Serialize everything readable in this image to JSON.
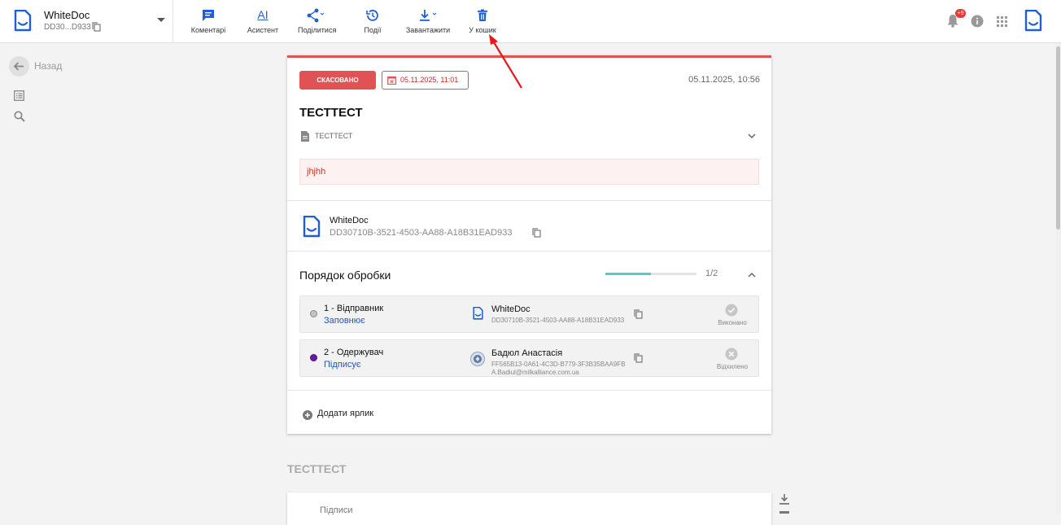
{
  "app": {
    "name": "WhiteDoc",
    "doc_id_short": "DD30...D933"
  },
  "toolbar": {
    "comments": "Коментарі",
    "assistant": "Асистент",
    "assistant_glyph": "AI",
    "share": "Поділитися",
    "events": "Події",
    "download": "Завантажити",
    "trash": "У кошик"
  },
  "header_right": {
    "notifications_badge": "+9"
  },
  "nav": {
    "back_label": "Назад"
  },
  "document": {
    "status": "СКАСОВАНО",
    "deadline": "05.11.2025, 11:01",
    "created": "05.11.2025, 10:56",
    "title": "ТЕСТТЕСТ",
    "type": "ТЕСТТЕСТ",
    "reason": "jhjhh",
    "organization": {
      "name": "WhiteDoc",
      "id": "DD30710B-3521-4503-AA88-A18B31EAD933"
    }
  },
  "route": {
    "title": "Порядок обробки",
    "progress": 0.5,
    "progress_text": "1/2",
    "steps": [
      {
        "role": "1 - Відправник",
        "action": "Заповнює",
        "name": "WhiteDoc",
        "id": "DD30710B-3521-4503-AA88-A18B31EAD933",
        "email": "",
        "status": "Виконано"
      },
      {
        "role": "2 - Одержувач",
        "action": "Підписує",
        "name": "Бадюл Анастасія",
        "id": "FF565B13-0A61-4C3D-B779-3F3B35BAA9FB",
        "email": "A.Badiul@milkalliance.com.ua",
        "status": "Відхилено"
      }
    ]
  },
  "labels": {
    "add_label": "Додати ярлик"
  },
  "lower": {
    "section_title": "ТЕСТТЕСТ",
    "signatures": "Підписи"
  },
  "colors": {
    "accent": "#1f5fd6",
    "danger": "#e05256",
    "progress": "#4ecdc4",
    "step1_dot": "#c4c4c4",
    "step2_dot": "#6a1b9a"
  }
}
